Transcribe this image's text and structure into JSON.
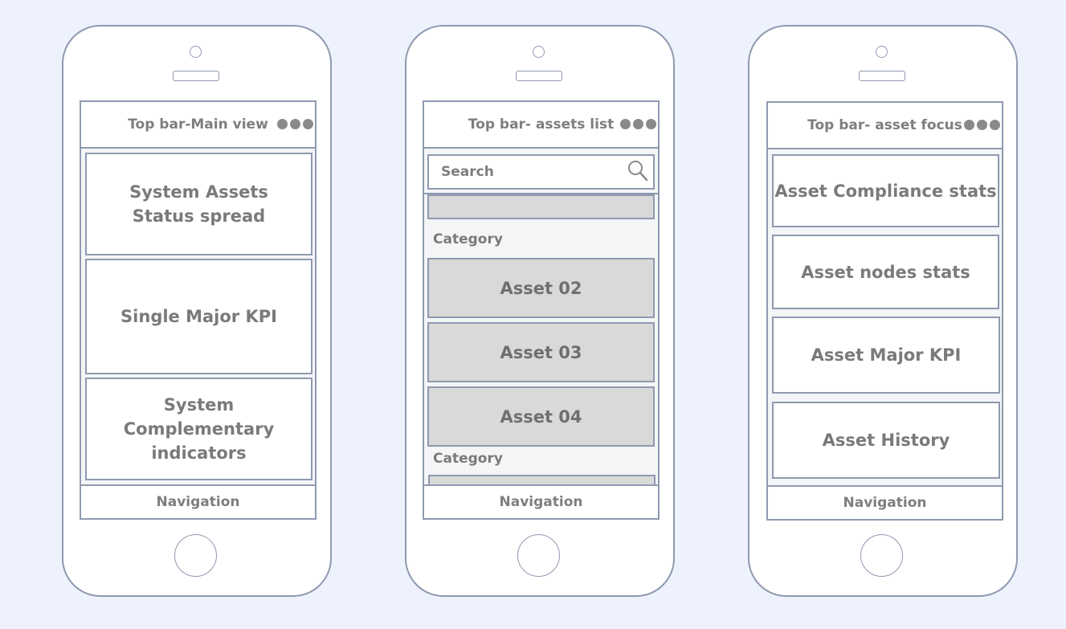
{
  "phones": [
    {
      "top_bar": {
        "title": "Top bar-Main view"
      },
      "cards": [
        {
          "lines": [
            "System Assets",
            "Status spread"
          ]
        },
        {
          "lines": [
            "Single Major KPI"
          ]
        },
        {
          "lines": [
            "System",
            "Complementary",
            "indicators"
          ]
        }
      ],
      "nav_label": "Navigation"
    },
    {
      "top_bar": {
        "title": "Top bar- assets list"
      },
      "search": {
        "placeholder": "Search"
      },
      "categories": [
        "Category",
        "Category"
      ],
      "assets": [
        "Asset 02",
        "Asset 03",
        "Asset 04"
      ],
      "nav_label": "Navigation"
    },
    {
      "top_bar": {
        "title": "Top bar- asset focus"
      },
      "cards": [
        {
          "lines": [
            "Asset Compliance stats"
          ]
        },
        {
          "lines": [
            "Asset nodes stats"
          ]
        },
        {
          "lines": [
            "Asset Major KPI"
          ]
        },
        {
          "lines": [
            "Asset History"
          ]
        }
      ],
      "nav_label": "Navigation"
    }
  ],
  "colors": {
    "background": "#edf2fc",
    "outline": "#8f9ab0",
    "asset_fill": "#d9d9d9",
    "text": "#7a7a7a"
  },
  "icons": [
    "menu-dots-icon",
    "search-icon",
    "camera-icon",
    "speaker-icon",
    "home-button-icon"
  ]
}
